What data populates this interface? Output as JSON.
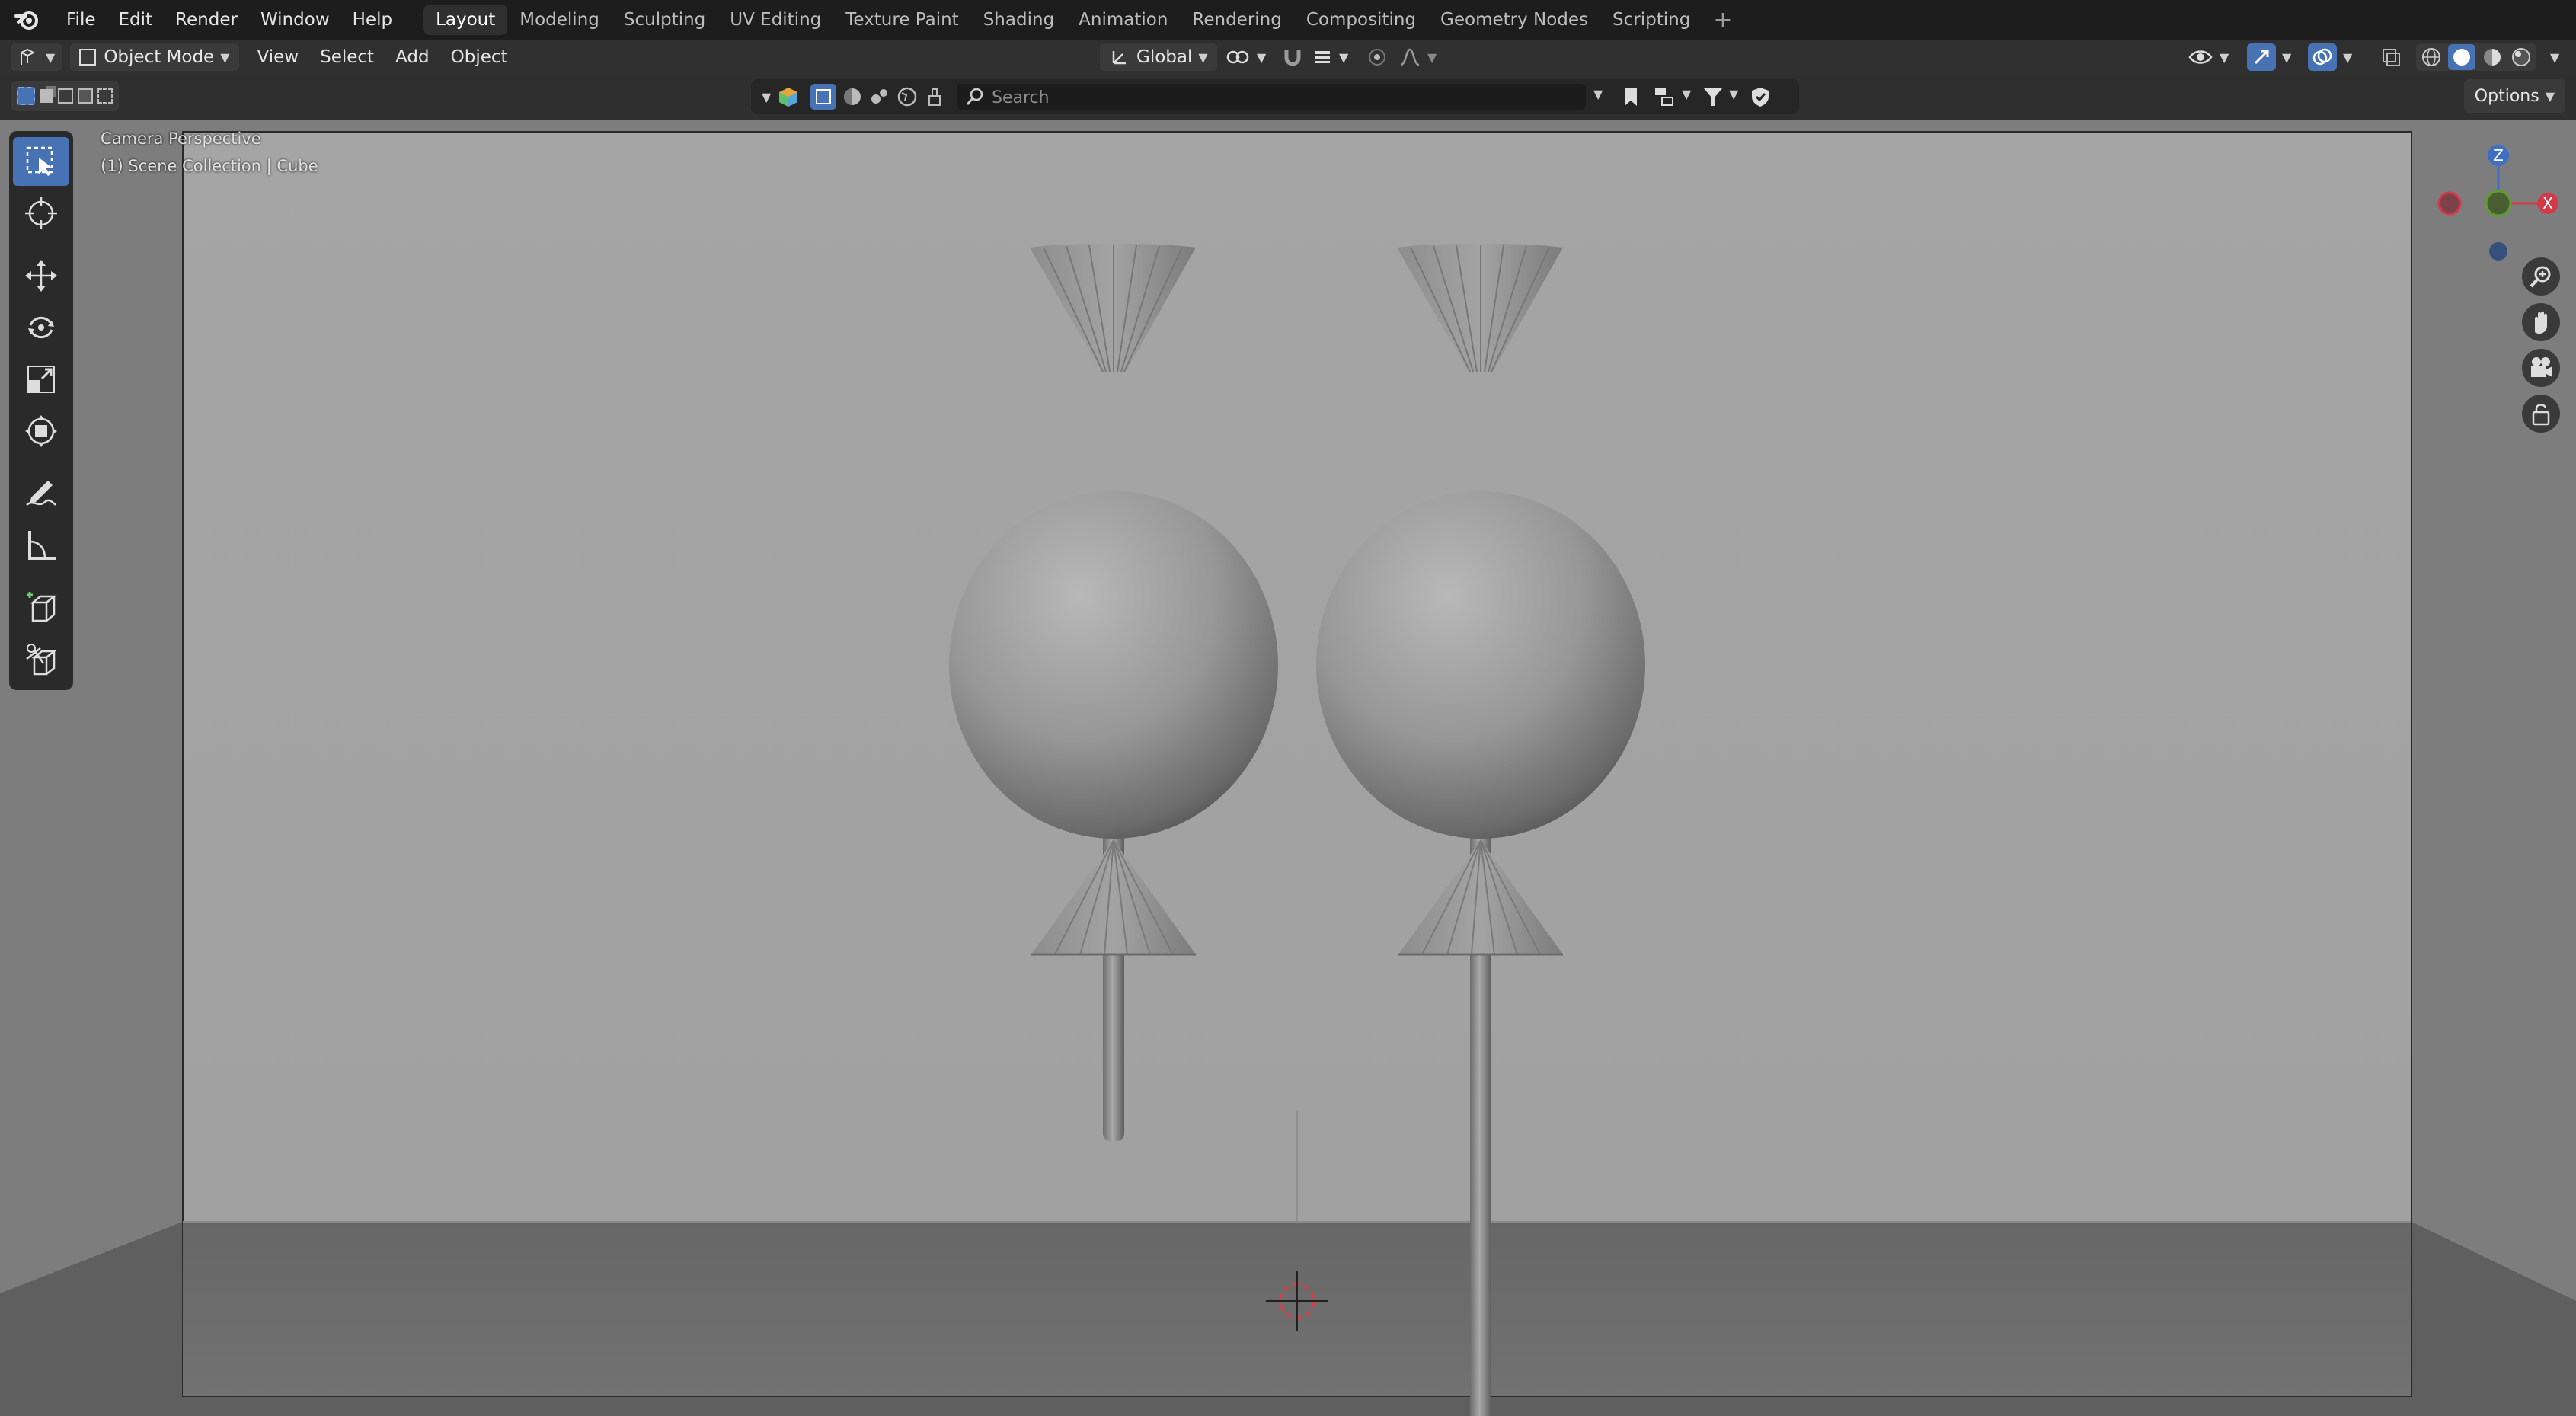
{
  "app": {
    "menus": [
      "File",
      "Edit",
      "Render",
      "Window",
      "Help"
    ],
    "workspaces": [
      "Layout",
      "Modeling",
      "Sculpting",
      "UV Editing",
      "Texture Paint",
      "Shading",
      "Animation",
      "Rendering",
      "Compositing",
      "Geometry Nodes",
      "Scripting"
    ],
    "active_workspace": "Layout",
    "add_workspace_icon": "plus-icon"
  },
  "header": {
    "mode": "Object Mode",
    "menus": [
      "View",
      "Select",
      "Add",
      "Object"
    ],
    "transform_orientation": "Global"
  },
  "outliner": {
    "search_placeholder": "Search"
  },
  "options_label": "Options",
  "viewport": {
    "view_name": "Camera Perspective",
    "collection_info": "(1) Scene Collection | Cube",
    "gizmo": {
      "z": "Z",
      "x": "X"
    },
    "colors": {
      "x_axis": "#d23a48",
      "y_axis": "#5f9d2a",
      "z_axis": "#3e6fc2",
      "active_tool": "#4772b3"
    }
  },
  "toolbar": {
    "tools": [
      "select-box",
      "cursor",
      "move",
      "rotate",
      "scale",
      "transform",
      "annotate",
      "measure",
      "add-cube",
      "cut"
    ]
  }
}
